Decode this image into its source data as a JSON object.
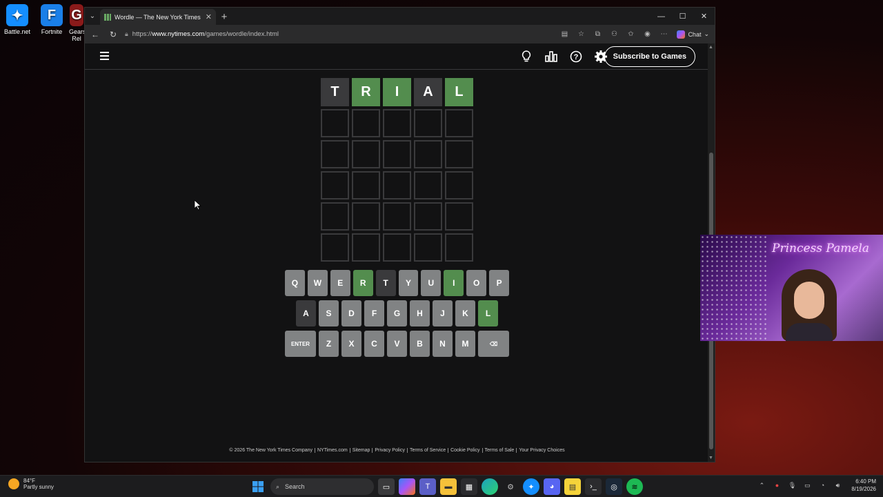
{
  "desktop": {
    "icons": [
      {
        "label": "Battle.net"
      },
      {
        "label": "Fortnite"
      },
      {
        "label": "Gears Rel"
      }
    ]
  },
  "browser": {
    "tab_title": "Wordle — The New York Times",
    "url_prefix": "https://",
    "url_host": "www.nytimes.com",
    "url_path": "/games/wordle/index.html",
    "chat_label": "Chat"
  },
  "game": {
    "subscribe_label": "Subscribe to Games",
    "board": [
      [
        {
          "letter": "T",
          "state": "absent"
        },
        {
          "letter": "R",
          "state": "correct"
        },
        {
          "letter": "I",
          "state": "correct"
        },
        {
          "letter": "A",
          "state": "absent"
        },
        {
          "letter": "L",
          "state": "correct"
        }
      ],
      [
        {
          "letter": "",
          "state": "empty"
        },
        {
          "letter": "",
          "state": "empty"
        },
        {
          "letter": "",
          "state": "empty"
        },
        {
          "letter": "",
          "state": "empty"
        },
        {
          "letter": "",
          "state": "empty"
        }
      ],
      [
        {
          "letter": "",
          "state": "empty"
        },
        {
          "letter": "",
          "state": "empty"
        },
        {
          "letter": "",
          "state": "empty"
        },
        {
          "letter": "",
          "state": "empty"
        },
        {
          "letter": "",
          "state": "empty"
        }
      ],
      [
        {
          "letter": "",
          "state": "empty"
        },
        {
          "letter": "",
          "state": "empty"
        },
        {
          "letter": "",
          "state": "empty"
        },
        {
          "letter": "",
          "state": "empty"
        },
        {
          "letter": "",
          "state": "empty"
        }
      ],
      [
        {
          "letter": "",
          "state": "empty"
        },
        {
          "letter": "",
          "state": "empty"
        },
        {
          "letter": "",
          "state": "empty"
        },
        {
          "letter": "",
          "state": "empty"
        },
        {
          "letter": "",
          "state": "empty"
        }
      ],
      [
        {
          "letter": "",
          "state": "empty"
        },
        {
          "letter": "",
          "state": "empty"
        },
        {
          "letter": "",
          "state": "empty"
        },
        {
          "letter": "",
          "state": "empty"
        },
        {
          "letter": "",
          "state": "empty"
        }
      ]
    ],
    "keyboard": [
      [
        {
          "k": "Q"
        },
        {
          "k": "W"
        },
        {
          "k": "E"
        },
        {
          "k": "R",
          "state": "correct"
        },
        {
          "k": "T",
          "state": "absent"
        },
        {
          "k": "Y"
        },
        {
          "k": "U"
        },
        {
          "k": "I",
          "state": "correct"
        },
        {
          "k": "O"
        },
        {
          "k": "P"
        }
      ],
      [
        {
          "k": "A",
          "state": "absent"
        },
        {
          "k": "S"
        },
        {
          "k": "D"
        },
        {
          "k": "F"
        },
        {
          "k": "G"
        },
        {
          "k": "H"
        },
        {
          "k": "J"
        },
        {
          "k": "K"
        },
        {
          "k": "L",
          "state": "correct"
        }
      ],
      [
        {
          "k": "ENTER",
          "wide": true
        },
        {
          "k": "Z"
        },
        {
          "k": "X"
        },
        {
          "k": "C"
        },
        {
          "k": "V"
        },
        {
          "k": "B"
        },
        {
          "k": "N"
        },
        {
          "k": "M"
        },
        {
          "k": "⌫",
          "wide": true,
          "name": "backspace"
        }
      ]
    ],
    "footer_links": [
      "© 2026 The New York Times Company",
      "NYTimes.com",
      "Sitemap",
      "Privacy Policy",
      "Terms of Service",
      "Cookie Policy",
      "Terms of Sale",
      "Your Privacy Choices"
    ]
  },
  "webcam": {
    "sign_text": "Princess Pamela"
  },
  "taskbar": {
    "temp": "84°F",
    "condition": "Partly sunny",
    "search_label": "Search",
    "time": "6:40 PM",
    "date": "8/19/2026"
  },
  "colors": {
    "correct": "#538d4e",
    "absent": "#3a3a3c",
    "key_default": "#818384"
  }
}
